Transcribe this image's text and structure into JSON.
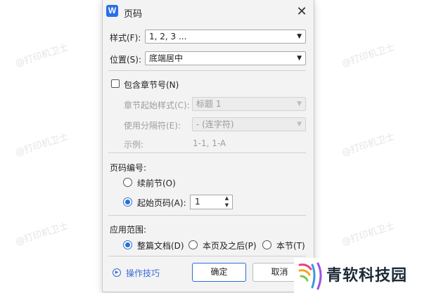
{
  "watermark": "@打印机卫士",
  "dialog": {
    "title": "页码",
    "app_icon_letter": "W",
    "close_glyph": "✕"
  },
  "style_row": {
    "label": "样式(F):",
    "value": "1, 2, 3 ..."
  },
  "position_row": {
    "label": "位置(S):",
    "value": "底端居中"
  },
  "chapter": {
    "checkbox_label": "包含章节号(N)",
    "checked": false,
    "start_style_label": "章节起始样式(C):",
    "start_style_value": "标题 1",
    "separator_label": "使用分隔符(E):",
    "separator_value": "-    (连字符)",
    "example_label": "示例:",
    "example_value": "1-1, 1-A"
  },
  "numbering": {
    "heading": "页码编号:",
    "continue_label": "续前节(O)",
    "start_label": "起始页码(A):",
    "start_value": "1",
    "selected": "start"
  },
  "apply": {
    "heading": "应用范围:",
    "options": [
      "整篇文档(D)",
      "本页及之后(P)",
      "本节(T)"
    ],
    "selected": "整篇文档(D)"
  },
  "footer": {
    "tips_label": "操作技巧",
    "ok_label": "确定",
    "cancel_label": "取消"
  },
  "overlay_logo": {
    "text": "青软科技园"
  },
  "colors": {
    "accent": "#2a6fd6",
    "dialog_bg": "#f3f3f3",
    "link": "#3c6bd6"
  }
}
